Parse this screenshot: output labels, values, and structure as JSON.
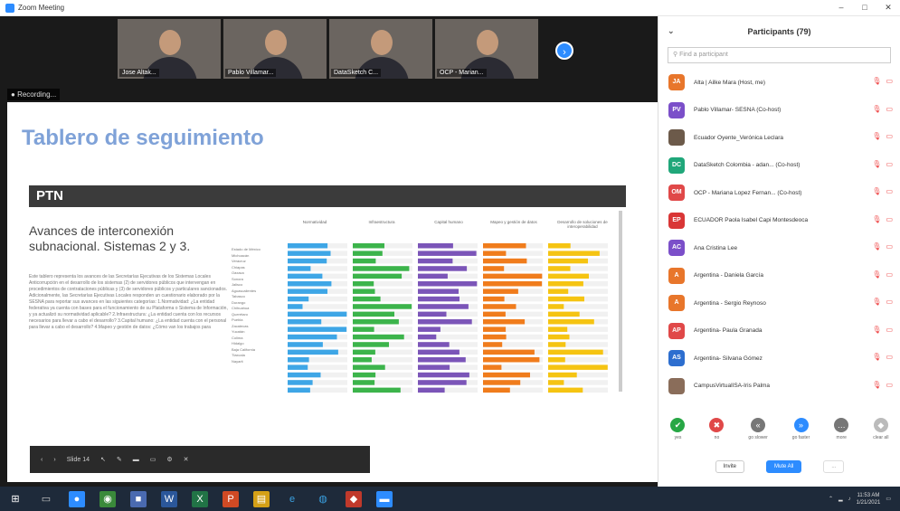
{
  "window": {
    "title": "Zoom Meeting"
  },
  "videos": [
    {
      "name": "Jose Altak..."
    },
    {
      "name": "Pablo Villamar..."
    },
    {
      "name": "DataSketch C..."
    },
    {
      "name": "OCP - Marian..."
    }
  ],
  "recording": {
    "label": "Recording..."
  },
  "slide": {
    "title": "Tablero de seguimiento",
    "logo": "PTN",
    "panel_title": "Avances de interconexión subnacional. Sistemas 2 y 3.",
    "panel_text": "Este tablero representa los avances de las Secretarías Ejecutivas de los Sistemas Locales Anticorrupción en el desarrollo de los sistemas (2) de servidores públicos que intervengan en procedimientos de contrataciones públicas y (3) de servidores públicos y particulares sancionados. Adicionalmente, las Secretarías Ejecutivas Locales responden un cuestionario elaborado por la SESNA para reportar sus avances en las siguientes categorías: 1.Normatividad: ¿La entidad federativa ya cuenta con bases para el funcionamiento de su Plataforma o Sistema de Información, y ya actualizó su normatividad aplicable? 2.Infraestructura: ¿La entidad cuenta con los recursos necesarios para llevar a cabo el desarrollo? 3.Capital humano: ¿La entidad cuenta con el personal para llevar a cabo el desarrollo? 4.Mapeo y gestión de datos: ¿Cómo van los trabajos para",
    "columns": [
      "Normatividad",
      "Infraestructura",
      "Capital humano",
      "Mapeo y gestión de datos",
      "Desarrollo de soluciones de interoperabilidad"
    ],
    "row_labels": [
      "Estado de México",
      "Michoacán",
      "Veracruz",
      "Chiapas",
      "Oaxaca",
      "Sonora",
      "Jalisco",
      "Aguascalientes",
      "Tabasco",
      "Durango",
      "Chihuahua",
      "Querétaro",
      "Puebla",
      "Zacatecas",
      "Yucatán",
      "Colima",
      "Hidalgo",
      "Baja California",
      "Tlaxcala",
      "Nayarit"
    ],
    "column_colors": [
      "#3ea6e6",
      "#3cb44b",
      "#7b55b8",
      "#f07c1c",
      "#f5c412"
    ]
  },
  "slide_toolbar": {
    "page": "Slide 14"
  },
  "participants_panel": {
    "title": "Participants (79)",
    "search_placeholder": "Find a participant",
    "participants": [
      {
        "initials": "JA",
        "color": "#e8762b",
        "name": "Alta | Ailke Mara (Host, me)"
      },
      {
        "initials": "PV",
        "color": "#7b4fc9",
        "name": "Pablo Villamar- SESNA (Co-host)"
      },
      {
        "initials": "",
        "color": "#6c5a4a",
        "name": "Ecuador Oyente_Verónica Leclara"
      },
      {
        "initials": "DC",
        "color": "#20a77a",
        "name": "DataSketch Colombia - adan... (Co-host)"
      },
      {
        "initials": "OM",
        "color": "#e04848",
        "name": "OCP - Mariana Lopez Fernan... (Co-host)"
      },
      {
        "initials": "EP",
        "color": "#d93636",
        "name": "ECUADOR Paola Isabel Capi Montesdeoca"
      },
      {
        "initials": "AC",
        "color": "#7b4fc9",
        "name": "Ana Cristina Lee"
      },
      {
        "initials": "A",
        "color": "#e8762b",
        "name": "Argentina - Daniela García"
      },
      {
        "initials": "A",
        "color": "#e8762b",
        "name": "Argentina - Sergio Reynoso"
      },
      {
        "initials": "AP",
        "color": "#e04848",
        "name": "Argentina- Paula Granada"
      },
      {
        "initials": "AS",
        "color": "#2d6ecf",
        "name": "Argentina- Silvana Gómez"
      },
      {
        "initials": "",
        "color": "#8a6d5a",
        "name": "CampusVirtualISA-Iris Palma"
      }
    ],
    "reactions": [
      {
        "label": "yes",
        "color": "#27a745",
        "icon": "✔"
      },
      {
        "label": "no",
        "color": "#e04848",
        "icon": "✖"
      },
      {
        "label": "go slower",
        "color": "#777777",
        "icon": "«"
      },
      {
        "label": "go faster",
        "color": "#2d8cff",
        "icon": "»"
      },
      {
        "label": "more",
        "color": "#777777",
        "icon": "…"
      },
      {
        "label": "clear all",
        "color": "#bbbbbb",
        "icon": "◆"
      }
    ],
    "footer": {
      "invite": "Invite",
      "mute_all": "Mute All",
      "more": "..."
    }
  },
  "taskbar": {
    "time": "11:53 AM",
    "date": "1/21/2021"
  }
}
